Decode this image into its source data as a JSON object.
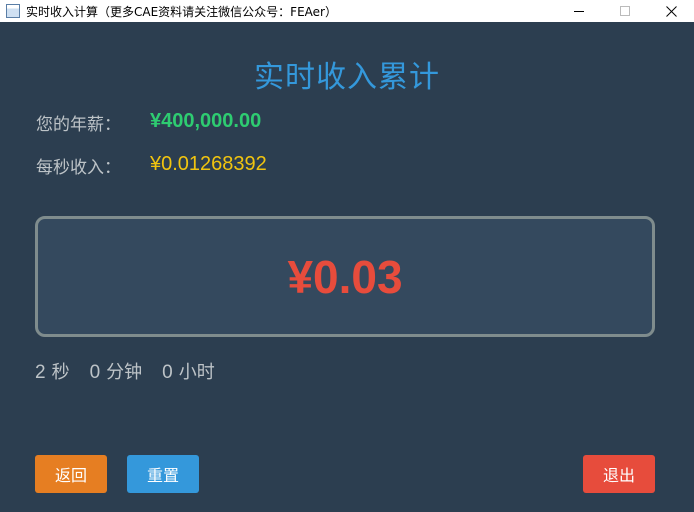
{
  "window": {
    "title": "实时收入计算（更多CAE资料请关注微信公众号：FEAer）"
  },
  "main": {
    "heading": "实时收入累计",
    "salary": {
      "label": "您的年薪：",
      "value": "¥400,000.00"
    },
    "per_second": {
      "label": "每秒收入：",
      "value": "¥0.01268392"
    },
    "earned": "¥0.03",
    "timer": {
      "seconds_value": "2",
      "seconds_unit": "秒",
      "minutes_value": "0",
      "minutes_unit": "分钟",
      "hours_value": "0",
      "hours_unit": "小时"
    }
  },
  "buttons": {
    "back": "返回",
    "reset": "重置",
    "exit": "退出"
  },
  "colors": {
    "background": "#2c3e50",
    "heading": "#3498db",
    "salary": "#2ecc71",
    "per_second": "#f1c40f",
    "earned": "#e74c3c",
    "back_button": "#e67e22",
    "reset_button": "#3498db",
    "exit_button": "#e74c3c"
  },
  "icons": {
    "app": "app-window-icon",
    "minimize": "minimize-icon",
    "maximize": "maximize-icon",
    "close": "close-icon"
  }
}
